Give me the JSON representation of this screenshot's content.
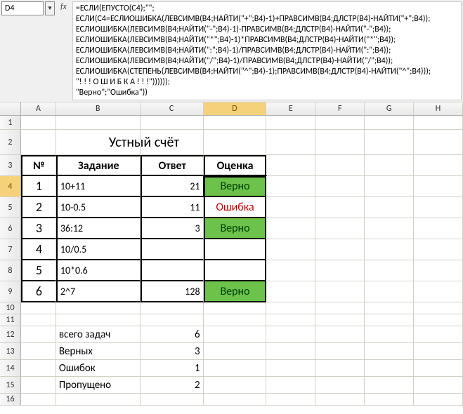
{
  "namebox": "D4",
  "fx_label": "fx",
  "formula": "=ЕСЛИ(ЕПУСТО(C4);\"\";\nЕСЛИ(C4=ЕСЛИОШИБКА(ЛЕВСИМВ(B4;НАЙТИ(\"+\";B4)-1)+ПРАВСИМВ(B4;ДЛСТР(B4)-НАЙТИ(\"+\";B4));\nЕСЛИОШИБКА(ЛЕВСИМВ(B4;НАЙТИ(\"-\";B4)-1)-ПРАВСИМВ(B4;ДЛСТР(B4)-НАЙТИ(\"-\";B4));\nЕСЛИОШИБКА(ЛЕВСИМВ(B4;НАЙТИ(\"*\";B4)-1)*ПРАВСИМВ(B4;ДЛСТР(B4)-НАЙТИ(\"*\";B4));\nЕСЛИОШИБКА(ЛЕВСИМВ(B4;НАЙТИ(\":\";B4)-1)/ПРАВСИМВ(B4;ДЛСТР(B4)-НАЙТИ(\":\";B4));\nЕСЛИОШИБКА(ЛЕВСИМВ(B4;НАЙТИ(\"/\";B4)-1)/ПРАВСИМВ(B4;ДЛСТР(B4)-НАЙТИ(\"/\";B4));\nЕСЛИОШИБКА(СТЕПЕНЬ(ЛЕВСИМВ(B4;НАЙТИ(\"^\";B4)-1);ПРАВСИМВ(B4;ДЛСТР(B4)-НАЙТИ(\"^\";B4)));\n\"! ! ! О Ш И Б К А ! ! !\"))))));\n\"Верно\";\"Ошибка\"))",
  "columns": [
    "A",
    "B",
    "C",
    "D",
    "E",
    "F",
    "G",
    "H"
  ],
  "title": "Устный счёт",
  "headers": {
    "num": "№",
    "task": "Задание",
    "answer": "Ответ",
    "grade": "Оценка"
  },
  "rows": [
    {
      "n": "1",
      "task": "10+11",
      "ans": "21",
      "grade": "Верно",
      "gradeClass": "green"
    },
    {
      "n": "2",
      "task": "10-0.5",
      "ans": "11",
      "grade": "Ошибка",
      "gradeClass": "red-text"
    },
    {
      "n": "3",
      "task": "36:12",
      "ans": "3",
      "grade": "Верно",
      "gradeClass": "green"
    },
    {
      "n": "4",
      "task": "10/0.5",
      "ans": "",
      "grade": "",
      "gradeClass": ""
    },
    {
      "n": "5",
      "task": "10*0.6",
      "ans": "",
      "grade": "",
      "gradeClass": ""
    },
    {
      "n": "6",
      "task": "2^7",
      "ans": "128",
      "grade": "Верно",
      "gradeClass": "green"
    }
  ],
  "stats": [
    {
      "label": "всего задач",
      "val": "6"
    },
    {
      "label": "Верных",
      "val": "3"
    },
    {
      "label": "Ошибок",
      "val": "1"
    },
    {
      "label": "Пропущено",
      "val": "2"
    }
  ]
}
